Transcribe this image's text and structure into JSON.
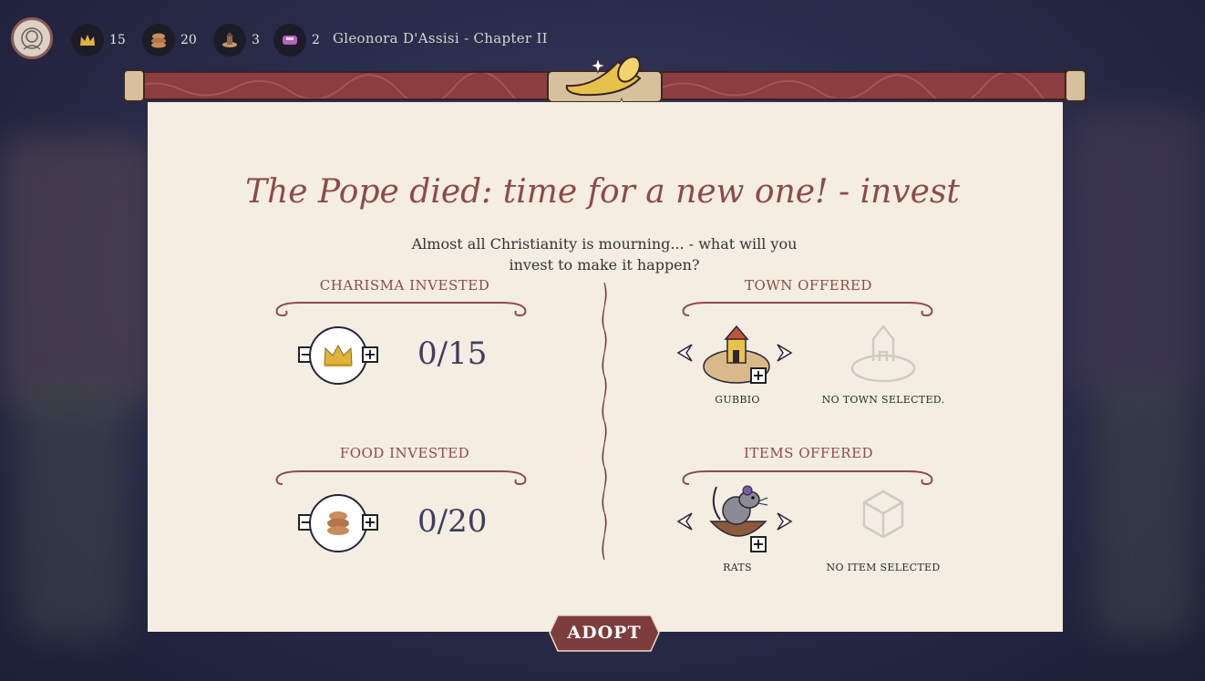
{
  "hud": {
    "resources": [
      {
        "icon": "crown-icon",
        "value": "15"
      },
      {
        "icon": "bread-icon",
        "value": "20"
      },
      {
        "icon": "town-icon",
        "value": "3"
      },
      {
        "icon": "item-icon",
        "value": "2"
      }
    ],
    "title": "Gleonora D'Assisi - Chapter II"
  },
  "event": {
    "title": "The Pope died: time for a new one! - invest",
    "description": "Almost all Christianity is mourning... - what will you invest to make it happen?"
  },
  "charisma": {
    "heading": "CHARISMA INVESTED",
    "value": "0/15"
  },
  "food": {
    "heading": "FOOD INVESTED",
    "value": "0/20"
  },
  "town": {
    "heading": "TOWN OFFERED",
    "current": "GUBBIO",
    "selected": "NO TOWN SELECTED."
  },
  "items": {
    "heading": "ITEMS OFFERED",
    "current": "RATS",
    "selected": "NO ITEM SELECTED"
  },
  "adopt_label": "ADOPT",
  "colors": {
    "accent": "#8e4a4a",
    "paper": "#f3ede2",
    "rod": "#8c3d3f",
    "button": "#7d3d3e"
  }
}
